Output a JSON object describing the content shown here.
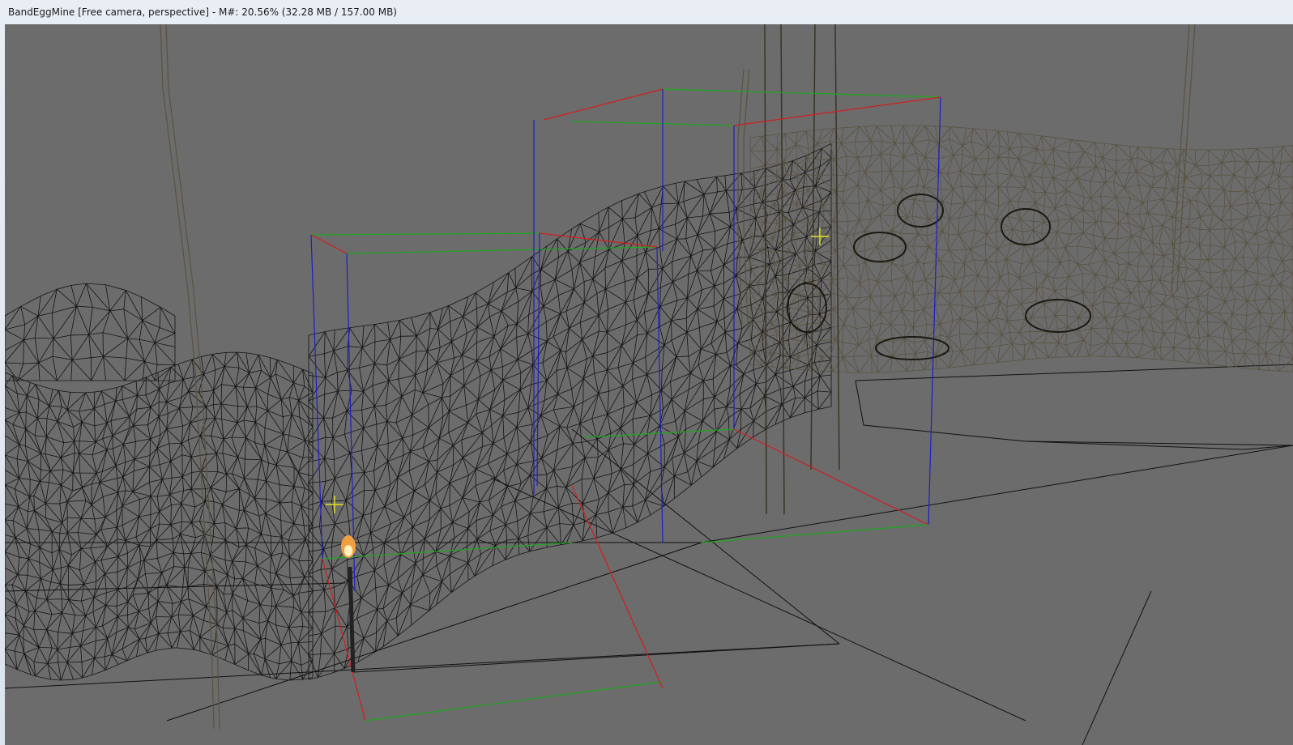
{
  "window": {
    "title": "BandEggMine [Free camera, perspective] - M#: 20.56% (32.28 MB / 157.00 MB)"
  },
  "viewport": {
    "background_color": "#6c6c6c",
    "wire_color": "#141414",
    "texture_wire_color": "#5a5340",
    "bbox_colors": {
      "x": "#d21e1e",
      "y": "#1ea81e",
      "z": "#1e1ec8"
    },
    "marker_color": "#e0e020",
    "torch_flame_color": "#f0a040"
  }
}
